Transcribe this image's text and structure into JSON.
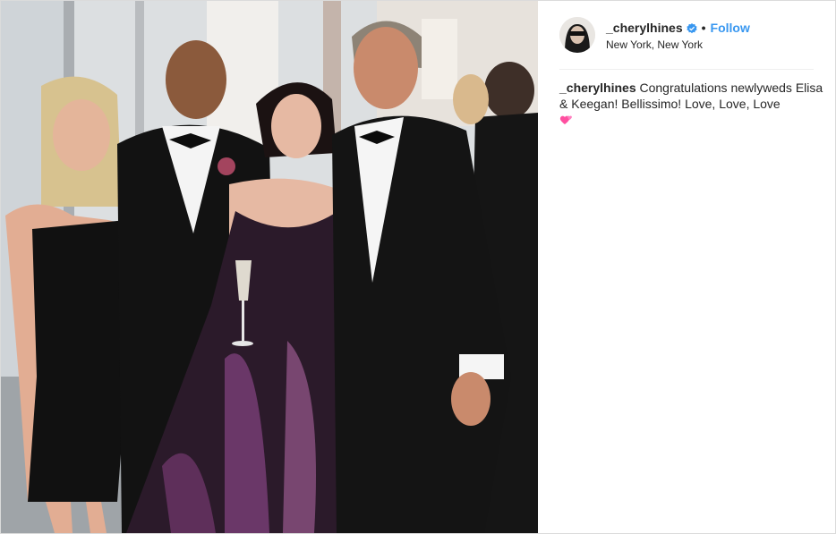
{
  "post": {
    "username": "_cherylhines",
    "follow_label": "Follow",
    "separator": "•",
    "location": "New York, New York",
    "verified_icon": "verified-badge-icon",
    "caption_username": "_cherylhines",
    "caption_text": "Congratulations newlyweds Elisa & Keegan! Bellissimo! Love, Love, Love",
    "caption_emoji_icon": "two-hearts-icon",
    "photo_description_icon": "photo"
  },
  "colors": {
    "link_blue": "#3897f0",
    "text": "#262626",
    "border": "#dbdbdb",
    "heart_pink": "#ff4fa0"
  }
}
